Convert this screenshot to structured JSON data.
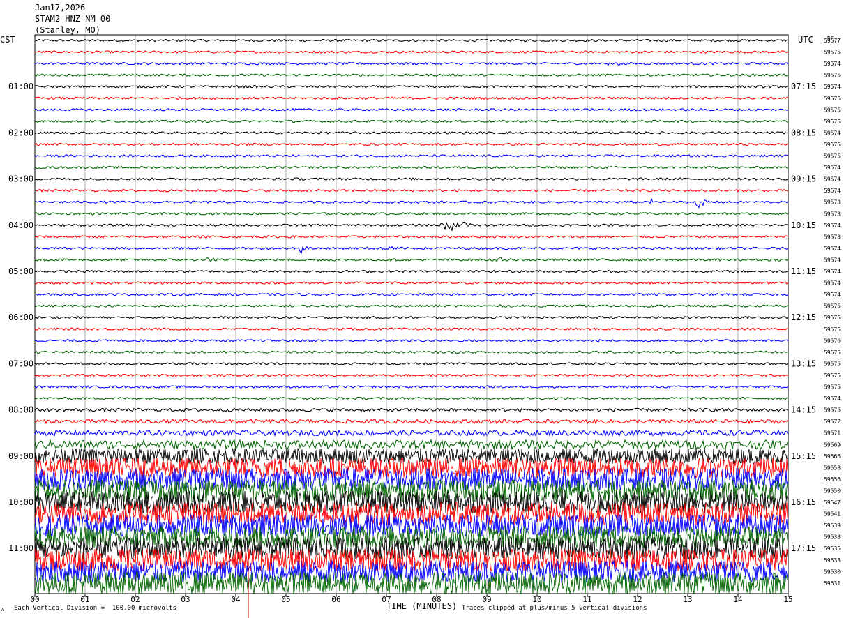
{
  "header": {
    "date": "Jan17,2026",
    "station": "STAM2 HNZ NM 00",
    "location": "(Stanley, MO)"
  },
  "left_zone": "CST",
  "right_zone": "UTC",
  "dc_label": "DC",
  "xaxis_title": "TIME (MINUTES)",
  "footer": {
    "mark": "A",
    "scale_note": "Each Vertical Division =  100.00 microvolts",
    "clip_note": "Traces clipped at plus/minus 5 vertical divisions"
  },
  "colors": {
    "trace_cycle": [
      "#000000",
      "#ff0000",
      "#0000ff",
      "#006400"
    ],
    "grid": "#000000",
    "marker": "#cc0000"
  },
  "chart_data": {
    "type": "line",
    "title": "",
    "xlabel": "TIME (MINUTES)",
    "ylabel": "",
    "xlim": [
      0,
      15
    ],
    "x_ticks": [
      "00",
      "01",
      "02",
      "03",
      "04",
      "05",
      "06",
      "07",
      "08",
      "09",
      "10",
      "11",
      "12",
      "13",
      "14",
      "15"
    ],
    "left_time_labels": [
      {
        "row": 4,
        "label": "01:00"
      },
      {
        "row": 8,
        "label": "02:00"
      },
      {
        "row": 12,
        "label": "03:00"
      },
      {
        "row": 16,
        "label": "04:00"
      },
      {
        "row": 20,
        "label": "05:00"
      },
      {
        "row": 24,
        "label": "06:00"
      },
      {
        "row": 28,
        "label": "07:00"
      },
      {
        "row": 32,
        "label": "08:00"
      },
      {
        "row": 36,
        "label": "09:00"
      },
      {
        "row": 40,
        "label": "10:00"
      },
      {
        "row": 44,
        "label": "11:00"
      }
    ],
    "right_time_labels": [
      {
        "row": 4,
        "label": "07:15"
      },
      {
        "row": 8,
        "label": "08:15"
      },
      {
        "row": 12,
        "label": "09:15"
      },
      {
        "row": 16,
        "label": "10:15"
      },
      {
        "row": 20,
        "label": "11:15"
      },
      {
        "row": 24,
        "label": "12:15"
      },
      {
        "row": 28,
        "label": "13:15"
      },
      {
        "row": 32,
        "label": "14:15"
      },
      {
        "row": 36,
        "label": "15:15"
      },
      {
        "row": 40,
        "label": "16:15"
      },
      {
        "row": 44,
        "label": "17:15"
      }
    ],
    "dc_offsets": [
      "59577",
      "59575",
      "59574",
      "59575",
      "59574",
      "59575",
      "59575",
      "59575",
      "59574",
      "59575",
      "59575",
      "59574",
      "59574",
      "59574",
      "59573",
      "59573",
      "59574",
      "59573",
      "59574",
      "59574",
      "59574",
      "59574",
      "59574",
      "59575",
      "59575",
      "59575",
      "59576",
      "59575",
      "59575",
      "59575",
      "59575",
      "59574",
      "59575",
      "59572",
      "59571",
      "59569",
      "59566",
      "59558",
      "59556",
      "59550",
      "59547",
      "59541",
      "59539",
      "59538",
      "59535",
      "59533",
      "59530",
      "59531"
    ],
    "trace_noise_level": [
      0.5,
      0.5,
      0.5,
      0.5,
      0.5,
      0.5,
      0.5,
      0.5,
      0.5,
      0.5,
      0.5,
      0.5,
      0.5,
      0.5,
      0.5,
      0.5,
      0.5,
      0.5,
      0.5,
      0.5,
      0.5,
      0.5,
      0.5,
      0.5,
      0.5,
      0.5,
      0.5,
      0.5,
      0.5,
      0.5,
      0.5,
      0.5,
      0.7,
      0.9,
      1.2,
      2.0,
      3.5,
      4.5,
      5,
      5,
      5,
      5,
      5,
      5,
      5,
      5,
      5,
      5
    ],
    "events": [
      {
        "row": 2,
        "minute": 11.5,
        "amplitude": 2.5
      },
      {
        "row": 14,
        "minute": 12.3,
        "amplitude": 1.5
      },
      {
        "row": 14,
        "minute": 13.2,
        "amplitude": 4
      },
      {
        "row": 16,
        "minute": 8.25,
        "amplitude": 5
      },
      {
        "row": 16,
        "minute": 8.55,
        "amplitude": 2.5
      },
      {
        "row": 18,
        "minute": 5.3,
        "amplitude": 2
      },
      {
        "row": 18,
        "minute": 7.1,
        "amplitude": 1.5
      },
      {
        "row": 19,
        "minute": 3.5,
        "amplitude": 1.5
      },
      {
        "row": 19,
        "minute": 9.3,
        "amplitude": 1.2
      },
      {
        "row": 45,
        "minute": 4.2,
        "amplitude": 5
      }
    ],
    "marker_minute": 4.25,
    "grid": true
  }
}
